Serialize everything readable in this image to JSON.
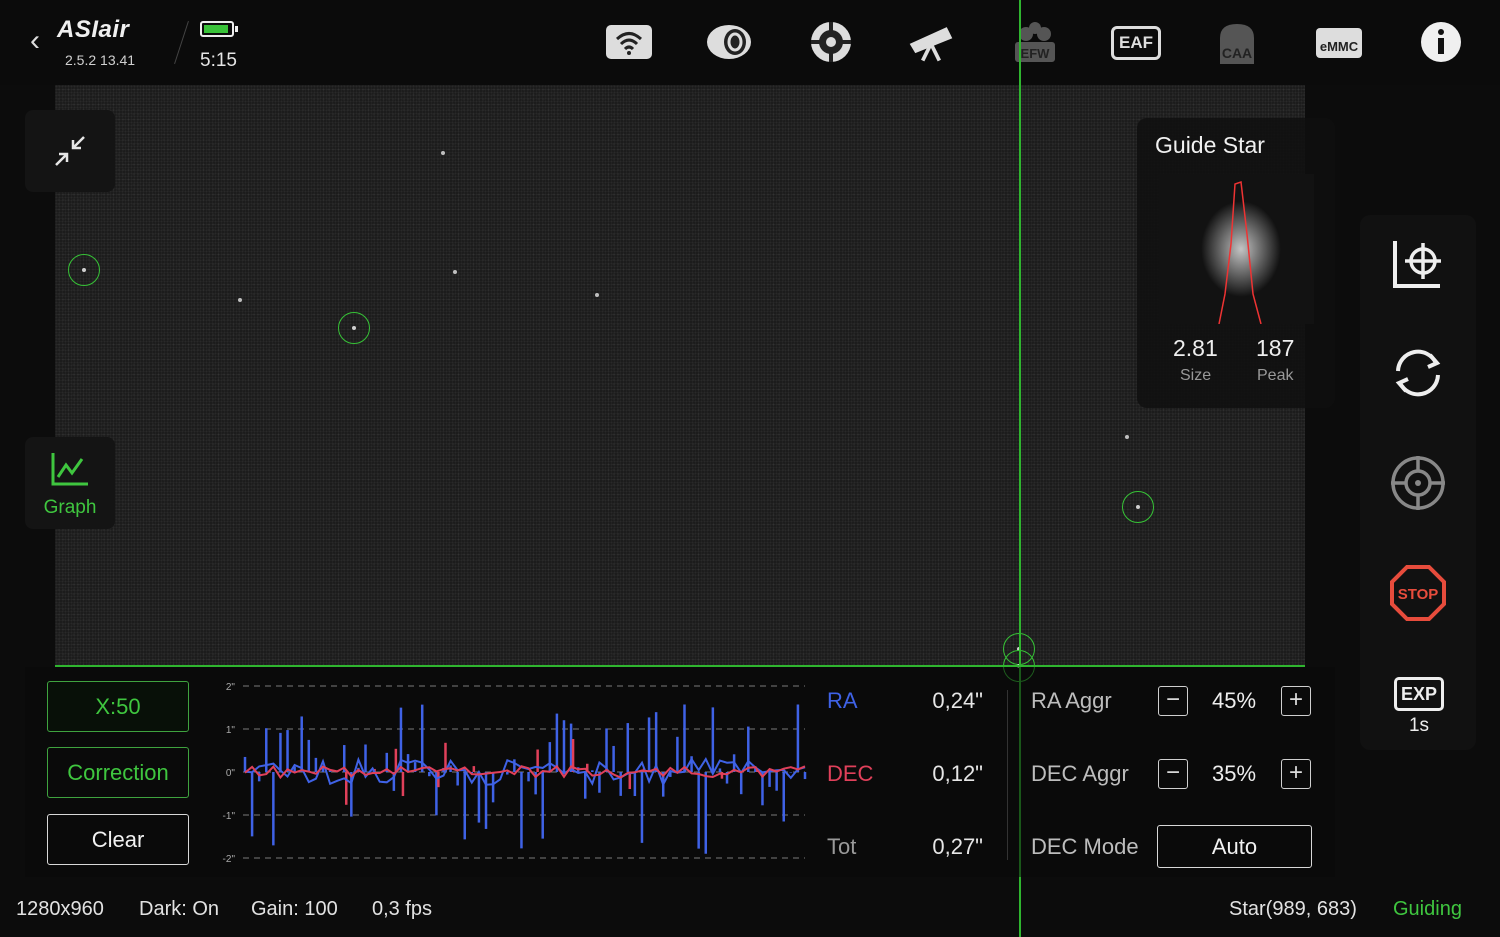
{
  "app": {
    "name": "ASIair",
    "version": "2.5.2 13.41"
  },
  "battery": {
    "time": "5:15",
    "color": "#39c239"
  },
  "top_icons": [
    "wifi-icon",
    "camera-icon",
    "guide-icon",
    "telescope-icon",
    "efw-icon",
    "eaf-icon",
    "caa-icon",
    "emmc-icon",
    "info-icon"
  ],
  "top_labels": {
    "efw": "EFW",
    "eaf": "EAF",
    "caa": "CAA",
    "emmc": "eMMC"
  },
  "graph_button": {
    "label": "Graph"
  },
  "guide_star": {
    "title": "Guide Star",
    "size": "2.81",
    "size_label": "Size",
    "peak": "187",
    "peak_label": "Peak"
  },
  "right_toolbar": {
    "exp_label": "EXP",
    "exp_value": "1s",
    "stop_label": "STOP"
  },
  "left_buttons": {
    "xscale": "X:50",
    "correction": "Correction",
    "clear": "Clear"
  },
  "graph": {
    "y_ticks": [
      "2\"",
      "1\"",
      "0\"",
      "-1\"",
      "-2\""
    ],
    "ra_color": "#3f62e6",
    "dec_color": "#e0405a"
  },
  "stats": {
    "ra_label": "RA",
    "ra_value": "0,24\"",
    "dec_label": "DEC",
    "dec_value": "0,12\"",
    "tot_label": "Tot",
    "tot_value": "0,27\""
  },
  "aggr": {
    "ra_label": "RA Aggr",
    "ra_value": "45%",
    "dec_label": "DEC Aggr",
    "dec_value": "35%",
    "dec_mode_label": "DEC Mode",
    "dec_mode_value": "Auto",
    "minus": "−",
    "plus": "+"
  },
  "status_bar": {
    "resolution": "1280x960",
    "dark": "Dark: On",
    "gain": "Gain: 100",
    "fps": "0,3 fps",
    "star": "Star(989, 683)",
    "state": "Guiding"
  },
  "accent_green": "#2fb52f"
}
